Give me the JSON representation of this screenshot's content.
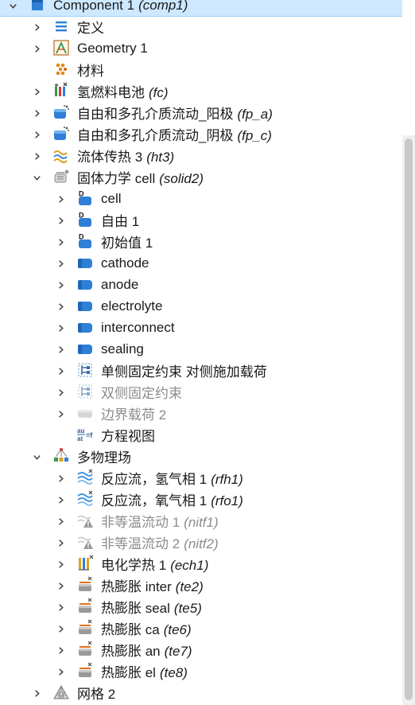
{
  "tree": [
    {
      "text": "Component 1",
      "tag": "(comp1)",
      "indent": 0,
      "expand": "open",
      "icon": "component-icon",
      "selected": true
    },
    {
      "text": "定义",
      "tag": "",
      "indent": 1,
      "expand": "closed",
      "icon": "definitions-icon"
    },
    {
      "text": "Geometry 1",
      "tag": "",
      "indent": 1,
      "expand": "closed",
      "icon": "geometry-icon"
    },
    {
      "text": "材料",
      "tag": "",
      "indent": 1,
      "expand": "none",
      "icon": "materials-icon"
    },
    {
      "text": "氢燃料电池",
      "tag": "(fc)",
      "indent": 1,
      "expand": "closed",
      "icon": "fuel-cell-icon"
    },
    {
      "text": "自由和多孔介质流动_阳极",
      "tag": "(fp_a)",
      "indent": 1,
      "expand": "closed",
      "icon": "porous-flow-icon"
    },
    {
      "text": "自由和多孔介质流动_阴极",
      "tag": "(fp_c)",
      "indent": 1,
      "expand": "closed",
      "icon": "porous-flow-icon"
    },
    {
      "text": "流体传热 3",
      "tag": "(ht3)",
      "indent": 1,
      "expand": "closed",
      "icon": "heat-transfer-icon"
    },
    {
      "text": "固体力学 cell",
      "tag": "(solid2)",
      "indent": 1,
      "expand": "open",
      "icon": "solid-mechanics-icon"
    },
    {
      "text": "cell",
      "tag": "",
      "indent": 2,
      "expand": "closed",
      "icon": "default-domain-icon"
    },
    {
      "text": "自由 1",
      "tag": "",
      "indent": 2,
      "expand": "closed",
      "icon": "default-domain-icon"
    },
    {
      "text": "初始值 1",
      "tag": "",
      "indent": 2,
      "expand": "closed",
      "icon": "default-domain-icon"
    },
    {
      "text": "cathode",
      "tag": "",
      "indent": 2,
      "expand": "closed",
      "icon": "domain-icon"
    },
    {
      "text": "anode",
      "tag": "",
      "indent": 2,
      "expand": "closed",
      "icon": "domain-icon"
    },
    {
      "text": "electrolyte",
      "tag": "",
      "indent": 2,
      "expand": "closed",
      "icon": "domain-icon"
    },
    {
      "text": "interconnect",
      "tag": "",
      "indent": 2,
      "expand": "closed",
      "icon": "domain-icon"
    },
    {
      "text": "sealing",
      "tag": "",
      "indent": 2,
      "expand": "closed",
      "icon": "domain-icon"
    },
    {
      "text": "单侧固定约束 对侧施加载荷",
      "tag": "",
      "indent": 2,
      "expand": "closed",
      "icon": "constraint-icon"
    },
    {
      "text": "双侧固定约束",
      "tag": "",
      "indent": 2,
      "expand": "closed",
      "icon": "constraint-icon",
      "disabled": true
    },
    {
      "text": "边界载荷 2",
      "tag": "",
      "indent": 2,
      "expand": "closed",
      "icon": "boundary-load-icon",
      "disabled": true
    },
    {
      "text": "方程视图",
      "tag": "",
      "indent": 2,
      "expand": "none",
      "icon": "equation-view-icon"
    },
    {
      "text": "多物理场",
      "tag": "",
      "indent": 1,
      "expand": "open",
      "icon": "multiphysics-icon"
    },
    {
      "text": "反应流，氢气相 1",
      "tag": "(rfh1)",
      "indent": 2,
      "expand": "closed",
      "icon": "reacting-flow-icon"
    },
    {
      "text": "反应流，氧气相 1",
      "tag": "(rfo1)",
      "indent": 2,
      "expand": "closed",
      "icon": "reacting-flow-icon"
    },
    {
      "text": "非等温流动 1",
      "tag": "(nitf1)",
      "indent": 2,
      "expand": "closed",
      "icon": "nonisothermal-warning-icon",
      "disabled": true
    },
    {
      "text": "非等温流动 2",
      "tag": "(nitf2)",
      "indent": 2,
      "expand": "closed",
      "icon": "nonisothermal-warning-icon",
      "disabled": true
    },
    {
      "text": "电化学热 1",
      "tag": "(ech1)",
      "indent": 2,
      "expand": "closed",
      "icon": "electrochemical-heat-icon"
    },
    {
      "text": "热膨胀 inter",
      "tag": "(te2)",
      "indent": 2,
      "expand": "closed",
      "icon": "thermal-expansion-icon"
    },
    {
      "text": "热膨胀 seal",
      "tag": "(te5)",
      "indent": 2,
      "expand": "closed",
      "icon": "thermal-expansion-icon"
    },
    {
      "text": "热膨胀 ca",
      "tag": "(te6)",
      "indent": 2,
      "expand": "closed",
      "icon": "thermal-expansion-icon"
    },
    {
      "text": "热膨胀 an",
      "tag": "(te7)",
      "indent": 2,
      "expand": "closed",
      "icon": "thermal-expansion-icon"
    },
    {
      "text": "热膨胀 el",
      "tag": "(te8)",
      "indent": 2,
      "expand": "closed",
      "icon": "thermal-expansion-icon"
    },
    {
      "text": "网格 2",
      "tag": "",
      "indent": 1,
      "expand": "closed",
      "icon": "mesh-icon"
    }
  ],
  "colors": {
    "selection": "#cde8ff",
    "icon_blue": "#2f7fd6",
    "disabled_text": "#8c8c8c"
  }
}
